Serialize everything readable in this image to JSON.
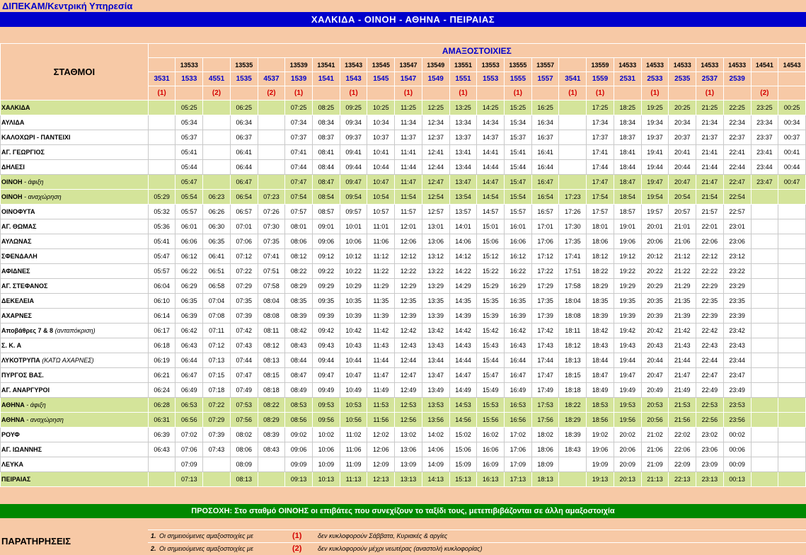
{
  "header": {
    "org": "ΔΙΠΕΚΑΜ/Κεντρική Υπηρεσία",
    "route": "ΧΑΛΚΙΔΑ - ΟΙΝΟΗ - ΑΘΗΝΑ - ΠΕΙΡΑΙΑΣ"
  },
  "table": {
    "stations_header": "ΣΤΑΘΜΟΙ",
    "trains_header": "ΑΜΑΞΟΣΤΟΙΧΙΕΣ",
    "columns": [
      {
        "top": "",
        "num": "3531",
        "mark": "(1)"
      },
      {
        "top": "13533",
        "num": "1533",
        "mark": ""
      },
      {
        "top": "",
        "num": "4551",
        "mark": "(2)"
      },
      {
        "top": "13535",
        "num": "1535",
        "mark": ""
      },
      {
        "top": "",
        "num": "4537",
        "mark": "(2)"
      },
      {
        "top": "13539",
        "num": "1539",
        "mark": "(1)"
      },
      {
        "top": "13541",
        "num": "1541",
        "mark": ""
      },
      {
        "top": "13543",
        "num": "1543",
        "mark": "(1)"
      },
      {
        "top": "13545",
        "num": "1545",
        "mark": ""
      },
      {
        "top": "13547",
        "num": "1547",
        "mark": "(1)"
      },
      {
        "top": "13549",
        "num": "1549",
        "mark": ""
      },
      {
        "top": "13551",
        "num": "1551",
        "mark": "(1)"
      },
      {
        "top": "13553",
        "num": "1553",
        "mark": ""
      },
      {
        "top": "13555",
        "num": "1555",
        "mark": "(1)"
      },
      {
        "top": "13557",
        "num": "1557",
        "mark": ""
      },
      {
        "top": "",
        "num": "3541",
        "mark": "(1)"
      },
      {
        "top": "13559",
        "num": "1559",
        "mark": "(1)"
      },
      {
        "top": "14533",
        "num": "2531",
        "mark": ""
      },
      {
        "top": "14533",
        "num": "2533",
        "mark": "(1)"
      },
      {
        "top": "14533",
        "num": "2535",
        "mark": ""
      },
      {
        "top": "14533",
        "num": "2537",
        "mark": "(1)"
      },
      {
        "top": "14533",
        "num": "2539",
        "mark": ""
      },
      {
        "top": "14541",
        "num": "",
        "mark": "(2)"
      },
      {
        "top": "14543",
        "num": "",
        "mark": ""
      }
    ],
    "rows": [
      {
        "name": "ΧΑΛΚΙΔΑ",
        "note": "",
        "style": "green",
        "times": [
          "",
          "05:25",
          "",
          "06:25",
          "",
          "07:25",
          "08:25",
          "09:25",
          "10:25",
          "11:25",
          "12:25",
          "13:25",
          "14:25",
          "15:25",
          "16:25",
          "",
          "17:25",
          "18:25",
          "19:25",
          "20:25",
          "21:25",
          "22:25",
          "23:25",
          "00:25"
        ]
      },
      {
        "name": "ΑΥΛΙΔΑ",
        "note": "",
        "style": "white",
        "times": [
          "",
          "05:34",
          "",
          "06:34",
          "",
          "07:34",
          "08:34",
          "09:34",
          "10:34",
          "11:34",
          "12:34",
          "13:34",
          "14:34",
          "15:34",
          "16:34",
          "",
          "17:34",
          "18:34",
          "19:34",
          "20:34",
          "21:34",
          "22:34",
          "23:34",
          "00:34"
        ]
      },
      {
        "name": "ΚΑΛΟΧΩΡΙ - ΠΑΝΤΕΙΧΙ",
        "note": "",
        "style": "white",
        "times": [
          "",
          "05:37",
          "",
          "06:37",
          "",
          "07:37",
          "08:37",
          "09:37",
          "10:37",
          "11:37",
          "12:37",
          "13:37",
          "14:37",
          "15:37",
          "16:37",
          "",
          "17:37",
          "18:37",
          "19:37",
          "20:37",
          "21:37",
          "22:37",
          "23:37",
          "00:37"
        ]
      },
      {
        "name": "ΑΓ. ΓΕΩΡΓΙΟΣ",
        "note": "",
        "style": "white",
        "times": [
          "",
          "05:41",
          "",
          "06:41",
          "",
          "07:41",
          "08:41",
          "09:41",
          "10:41",
          "11:41",
          "12:41",
          "13:41",
          "14:41",
          "15:41",
          "16:41",
          "",
          "17:41",
          "18:41",
          "19:41",
          "20:41",
          "21:41",
          "22:41",
          "23:41",
          "00:41"
        ]
      },
      {
        "name": "ΔΗΛΕΣΙ",
        "note": "",
        "style": "white",
        "times": [
          "",
          "05:44",
          "",
          "06:44",
          "",
          "07:44",
          "08:44",
          "09:44",
          "10:44",
          "11:44",
          "12:44",
          "13:44",
          "14:44",
          "15:44",
          "16:44",
          "",
          "17:44",
          "18:44",
          "19:44",
          "20:44",
          "21:44",
          "22:44",
          "23:44",
          "00:44"
        ]
      },
      {
        "name": "ΟΙΝΟΗ",
        "note": " - άφιξη",
        "style": "green",
        "times": [
          "",
          "05:47",
          "",
          "06:47",
          "",
          "07:47",
          "08:47",
          "09:47",
          "10:47",
          "11:47",
          "12:47",
          "13:47",
          "14:47",
          "15:47",
          "16:47",
          "",
          "17:47",
          "18:47",
          "19:47",
          "20:47",
          "21:47",
          "22:47",
          "23:47",
          "00:47"
        ]
      },
      {
        "name": "ΟΙΝΟΗ",
        "note": " - αναχώρηση",
        "style": "green",
        "times": [
          "05:29",
          "05:54",
          "06:23",
          "06:54",
          "07:23",
          "07:54",
          "08:54",
          "09:54",
          "10:54",
          "11:54",
          "12:54",
          "13:54",
          "14:54",
          "15:54",
          "16:54",
          "17:23",
          "17:54",
          "18:54",
          "19:54",
          "20:54",
          "21:54",
          "22:54",
          "",
          ""
        ]
      },
      {
        "name": "ΟΙΝΟΦΥΤΑ",
        "note": "",
        "style": "white",
        "times": [
          "05:32",
          "05:57",
          "06:26",
          "06:57",
          "07:26",
          "07:57",
          "08:57",
          "09:57",
          "10:57",
          "11:57",
          "12:57",
          "13:57",
          "14:57",
          "15:57",
          "16:57",
          "17:26",
          "17:57",
          "18:57",
          "19:57",
          "20:57",
          "21:57",
          "22:57",
          "",
          ""
        ]
      },
      {
        "name": "ΑΓ. ΘΩΜΑΣ",
        "note": "",
        "style": "white",
        "times": [
          "05:36",
          "06:01",
          "06:30",
          "07:01",
          "07:30",
          "08:01",
          "09:01",
          "10:01",
          "11:01",
          "12:01",
          "13:01",
          "14:01",
          "15:01",
          "16:01",
          "17:01",
          "17:30",
          "18:01",
          "19:01",
          "20:01",
          "21:01",
          "22:01",
          "23:01",
          "",
          ""
        ]
      },
      {
        "name": "ΑΥΛΩΝΑΣ",
        "note": "",
        "style": "white",
        "times": [
          "05:41",
          "06:06",
          "06:35",
          "07:06",
          "07:35",
          "08:06",
          "09:06",
          "10:06",
          "11:06",
          "12:06",
          "13:06",
          "14:06",
          "15:06",
          "16:06",
          "17:06",
          "17:35",
          "18:06",
          "19:06",
          "20:06",
          "21:06",
          "22:06",
          "23:06",
          "",
          ""
        ]
      },
      {
        "name": "ΣΦΕΝΔΑΛΗ",
        "note": "",
        "style": "white",
        "times": [
          "05:47",
          "06:12",
          "06:41",
          "07:12",
          "07:41",
          "08:12",
          "09:12",
          "10:12",
          "11:12",
          "12:12",
          "13:12",
          "14:12",
          "15:12",
          "16:12",
          "17:12",
          "17:41",
          "18:12",
          "19:12",
          "20:12",
          "21:12",
          "22:12",
          "23:12",
          "",
          ""
        ]
      },
      {
        "name": "ΑΦΙΔΝΕΣ",
        "note": "",
        "style": "white",
        "times": [
          "05:57",
          "06:22",
          "06:51",
          "07:22",
          "07:51",
          "08:22",
          "09:22",
          "10:22",
          "11:22",
          "12:22",
          "13:22",
          "14:22",
          "15:22",
          "16:22",
          "17:22",
          "17:51",
          "18:22",
          "19:22",
          "20:22",
          "21:22",
          "22:22",
          "23:22",
          "",
          ""
        ]
      },
      {
        "name": "ΑΓ. ΣΤΕΦΑΝΟΣ",
        "note": "",
        "style": "white",
        "times": [
          "06:04",
          "06:29",
          "06:58",
          "07:29",
          "07:58",
          "08:29",
          "09:29",
          "10:29",
          "11:29",
          "12:29",
          "13:29",
          "14:29",
          "15:29",
          "16:29",
          "17:29",
          "17:58",
          "18:29",
          "19:29",
          "20:29",
          "21:29",
          "22:29",
          "23:29",
          "",
          ""
        ]
      },
      {
        "name": "ΔΕΚΕΛΕΙΑ",
        "note": "",
        "style": "white",
        "times": [
          "06:10",
          "06:35",
          "07:04",
          "07:35",
          "08:04",
          "08:35",
          "09:35",
          "10:35",
          "11:35",
          "12:35",
          "13:35",
          "14:35",
          "15:35",
          "16:35",
          "17:35",
          "18:04",
          "18:35",
          "19:35",
          "20:35",
          "21:35",
          "22:35",
          "23:35",
          "",
          ""
        ]
      },
      {
        "name": "ΑΧΑΡΝΕΣ",
        "note": "",
        "style": "white",
        "times": [
          "06:14",
          "06:39",
          "07:08",
          "07:39",
          "08:08",
          "08:39",
          "09:39",
          "10:39",
          "11:39",
          "12:39",
          "13:39",
          "14:39",
          "15:39",
          "16:39",
          "17:39",
          "18:08",
          "18:39",
          "19:39",
          "20:39",
          "21:39",
          "22:39",
          "23:39",
          "",
          ""
        ]
      },
      {
        "name": "Αποβάθρες 7 & 8",
        "note": " (ανταπόκριση)",
        "style": "white",
        "times": [
          "06:17",
          "06:42",
          "07:11",
          "07:42",
          "08:11",
          "08:42",
          "09:42",
          "10:42",
          "11:42",
          "12:42",
          "13:42",
          "14:42",
          "15:42",
          "16:42",
          "17:42",
          "18:11",
          "18:42",
          "19:42",
          "20:42",
          "21:42",
          "22:42",
          "23:42",
          "",
          ""
        ]
      },
      {
        "name": "Σ. Κ. Α",
        "note": "",
        "style": "white",
        "times": [
          "06:18",
          "06:43",
          "07:12",
          "07:43",
          "08:12",
          "08:43",
          "09:43",
          "10:43",
          "11:43",
          "12:43",
          "13:43",
          "14:43",
          "15:43",
          "16:43",
          "17:43",
          "18:12",
          "18:43",
          "19:43",
          "20:43",
          "21:43",
          "22:43",
          "23:43",
          "",
          ""
        ]
      },
      {
        "name": "ΛΥΚΟΤΡΥΠΑ",
        "note": " (ΚΑΤΩ ΑΧΑΡΝΕΣ)",
        "style": "white",
        "times": [
          "06:19",
          "06:44",
          "07:13",
          "07:44",
          "08:13",
          "08:44",
          "09:44",
          "10:44",
          "11:44",
          "12:44",
          "13:44",
          "14:44",
          "15:44",
          "16:44",
          "17:44",
          "18:13",
          "18:44",
          "19:44",
          "20:44",
          "21:44",
          "22:44",
          "23:44",
          "",
          ""
        ]
      },
      {
        "name": "ΠΥΡΓΟΣ ΒΑΣ.",
        "note": "",
        "style": "white",
        "times": [
          "06:21",
          "06:47",
          "07:15",
          "07:47",
          "08:15",
          "08:47",
          "09:47",
          "10:47",
          "11:47",
          "12:47",
          "13:47",
          "14:47",
          "15:47",
          "16:47",
          "17:47",
          "18:15",
          "18:47",
          "19:47",
          "20:47",
          "21:47",
          "22:47",
          "23:47",
          "",
          ""
        ]
      },
      {
        "name": "ΑΓ. ΑΝΑΡΓΥΡΟΙ",
        "note": "",
        "style": "white",
        "times": [
          "06:24",
          "06:49",
          "07:18",
          "07:49",
          "08:18",
          "08:49",
          "09:49",
          "10:49",
          "11:49",
          "12:49",
          "13:49",
          "14:49",
          "15:49",
          "16:49",
          "17:49",
          "18:18",
          "18:49",
          "19:49",
          "20:49",
          "21:49",
          "22:49",
          "23:49",
          "",
          ""
        ]
      },
      {
        "name": "ΑΘΗΝΑ",
        "note": " - άφιξη",
        "style": "green",
        "times": [
          "06:28",
          "06:53",
          "07:22",
          "07:53",
          "08:22",
          "08:53",
          "09:53",
          "10:53",
          "11:53",
          "12:53",
          "13:53",
          "14:53",
          "15:53",
          "16:53",
          "17:53",
          "18:22",
          "18:53",
          "19:53",
          "20:53",
          "21:53",
          "22:53",
          "23:53",
          "",
          ""
        ]
      },
      {
        "name": "ΑΘΗΝΑ",
        "note": " - αναχώρηση",
        "style": "green",
        "times": [
          "06:31",
          "06:56",
          "07:29",
          "07:56",
          "08:29",
          "08:56",
          "09:56",
          "10:56",
          "11:56",
          "12:56",
          "13:56",
          "14:56",
          "15:56",
          "16:56",
          "17:56",
          "18:29",
          "18:56",
          "19:56",
          "20:56",
          "21:56",
          "22:56",
          "23:56",
          "",
          ""
        ]
      },
      {
        "name": "ΡΟΥΦ",
        "note": "",
        "style": "white",
        "times": [
          "06:39",
          "07:02",
          "07:39",
          "08:02",
          "08:39",
          "09:02",
          "10:02",
          "11:02",
          "12:02",
          "13:02",
          "14:02",
          "15:02",
          "16:02",
          "17:02",
          "18:02",
          "18:39",
          "19:02",
          "20:02",
          "21:02",
          "22:02",
          "23:02",
          "00:02",
          "",
          ""
        ]
      },
      {
        "name": "ΑΓ. ΙΩΑΝΝΗΣ",
        "note": "",
        "style": "white",
        "times": [
          "06:43",
          "07:06",
          "07:43",
          "08:06",
          "08:43",
          "09:06",
          "10:06",
          "11:06",
          "12:06",
          "13:06",
          "14:06",
          "15:06",
          "16:06",
          "17:06",
          "18:06",
          "18:43",
          "19:06",
          "20:06",
          "21:06",
          "22:06",
          "23:06",
          "00:06",
          "",
          ""
        ]
      },
      {
        "name": "ΛΕΥΚΑ",
        "note": "",
        "style": "white",
        "times": [
          "",
          "07:09",
          "",
          "08:09",
          "",
          "09:09",
          "10:09",
          "11:09",
          "12:09",
          "13:09",
          "14:09",
          "15:09",
          "16:09",
          "17:09",
          "18:09",
          "",
          "19:09",
          "20:09",
          "21:09",
          "22:09",
          "23:09",
          "00:09",
          "",
          ""
        ]
      },
      {
        "name": "ΠΕΙΡΑΙΑΣ",
        "note": "",
        "style": "green",
        "times": [
          "",
          "07:13",
          "",
          "08:13",
          "",
          "09:13",
          "10:13",
          "11:13",
          "12:13",
          "13:13",
          "14:13",
          "15:13",
          "16:13",
          "17:13",
          "18:13",
          "",
          "19:13",
          "20:13",
          "21:13",
          "22:13",
          "23:13",
          "00:13",
          "",
          ""
        ]
      }
    ]
  },
  "notice": "ΠΡΟΣΟΧΗ: Στο σταθμό ΟΙΝΟΗΣ οι επιβάτες που συνεχίζουν το ταξίδι τους, μετεπιβιβάζονται σε άλλη αμαξοστοιχία",
  "remarks": {
    "title": "ΠΑΡΑΤΗΡΗΣΕΙΣ",
    "items": [
      {
        "num": "1.",
        "text": "Οι σημειούμενες αμαξοστοιχίες με",
        "mark": "(1)",
        "desc": "δεν κυκλοφορούν Σάββατα, Κυριακές & αργίες"
      },
      {
        "num": "2.",
        "text": "Οι σημειούμενες αμαξοστοιχίες με",
        "mark": "(2)",
        "desc": "δεν κυκλοφορούν μέχρι νεωτέρας (αναστολή κυκλοφορίας)"
      }
    ]
  },
  "colors": {
    "background": "#f7c9a6",
    "route_bar": "#0000cc",
    "green_row": "#d4e49a",
    "notice_bar": "#008800",
    "mark_red": "#d40000"
  }
}
